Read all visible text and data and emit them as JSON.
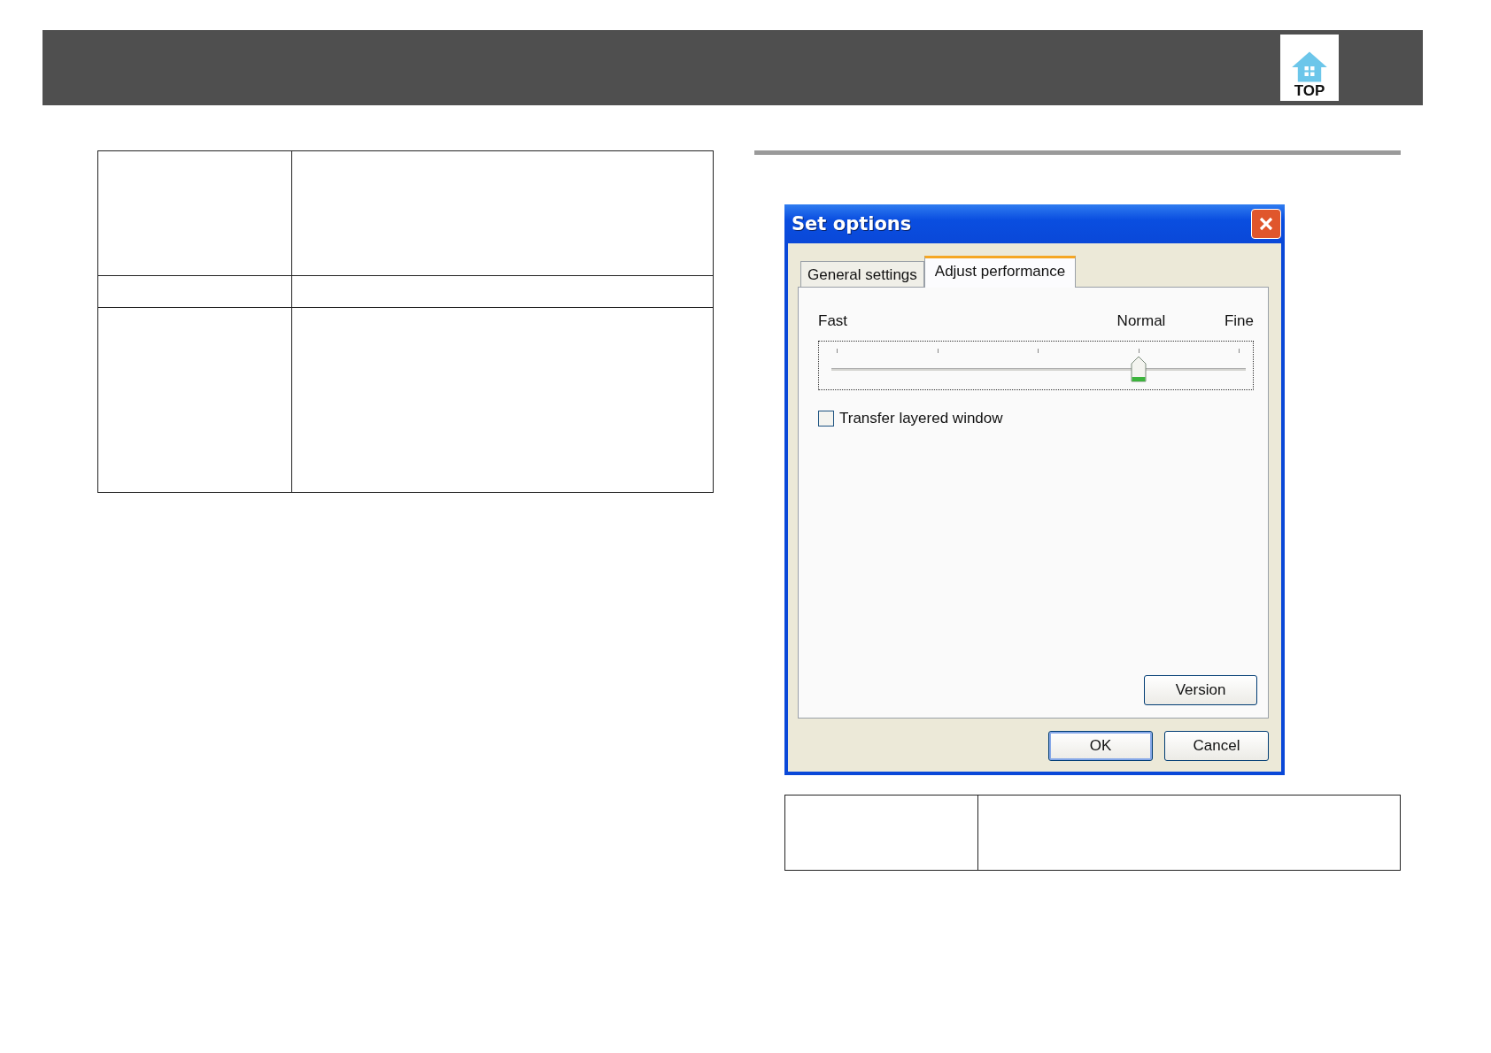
{
  "header": {
    "top_link": "TOP"
  },
  "dialog": {
    "title": "Set options",
    "tabs": [
      {
        "label": "General settings",
        "selected": false
      },
      {
        "label": "Adjust performance",
        "selected": true
      }
    ],
    "slider": {
      "label_left": "Fast",
      "label_middle": "Normal",
      "label_right": "Fine",
      "level": 0.75
    },
    "checkbox": {
      "label": "Transfer layered window",
      "checked": false
    },
    "version_button": "Version",
    "buttons": [
      "OK",
      "Cancel"
    ]
  }
}
